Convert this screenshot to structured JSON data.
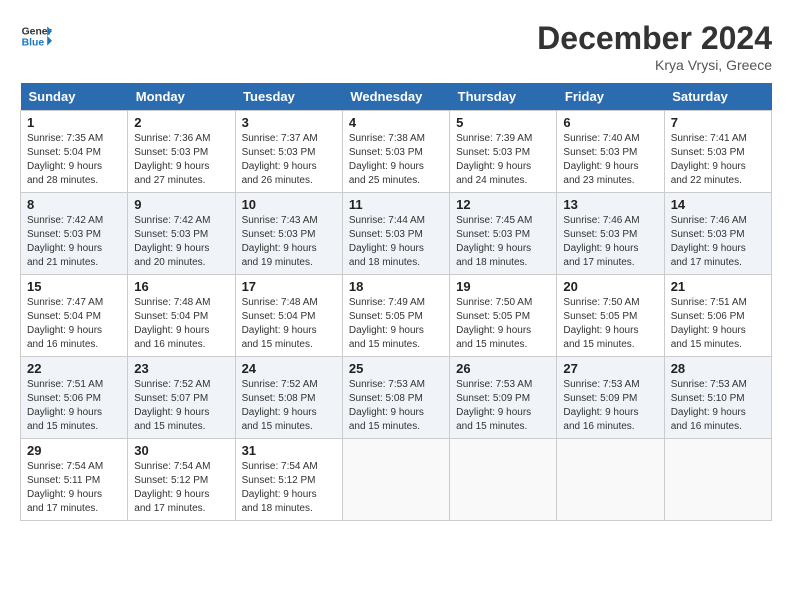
{
  "header": {
    "logo_line1": "General",
    "logo_line2": "Blue",
    "month_title": "December 2024",
    "location": "Krya Vrysi, Greece"
  },
  "weekdays": [
    "Sunday",
    "Monday",
    "Tuesday",
    "Wednesday",
    "Thursday",
    "Friday",
    "Saturday"
  ],
  "weeks": [
    [
      {
        "day": "1",
        "sunrise": "Sunrise: 7:35 AM",
        "sunset": "Sunset: 5:04 PM",
        "daylight": "Daylight: 9 hours and 28 minutes."
      },
      {
        "day": "2",
        "sunrise": "Sunrise: 7:36 AM",
        "sunset": "Sunset: 5:03 PM",
        "daylight": "Daylight: 9 hours and 27 minutes."
      },
      {
        "day": "3",
        "sunrise": "Sunrise: 7:37 AM",
        "sunset": "Sunset: 5:03 PM",
        "daylight": "Daylight: 9 hours and 26 minutes."
      },
      {
        "day": "4",
        "sunrise": "Sunrise: 7:38 AM",
        "sunset": "Sunset: 5:03 PM",
        "daylight": "Daylight: 9 hours and 25 minutes."
      },
      {
        "day": "5",
        "sunrise": "Sunrise: 7:39 AM",
        "sunset": "Sunset: 5:03 PM",
        "daylight": "Daylight: 9 hours and 24 minutes."
      },
      {
        "day": "6",
        "sunrise": "Sunrise: 7:40 AM",
        "sunset": "Sunset: 5:03 PM",
        "daylight": "Daylight: 9 hours and 23 minutes."
      },
      {
        "day": "7",
        "sunrise": "Sunrise: 7:41 AM",
        "sunset": "Sunset: 5:03 PM",
        "daylight": "Daylight: 9 hours and 22 minutes."
      }
    ],
    [
      {
        "day": "8",
        "sunrise": "Sunrise: 7:42 AM",
        "sunset": "Sunset: 5:03 PM",
        "daylight": "Daylight: 9 hours and 21 minutes."
      },
      {
        "day": "9",
        "sunrise": "Sunrise: 7:42 AM",
        "sunset": "Sunset: 5:03 PM",
        "daylight": "Daylight: 9 hours and 20 minutes."
      },
      {
        "day": "10",
        "sunrise": "Sunrise: 7:43 AM",
        "sunset": "Sunset: 5:03 PM",
        "daylight": "Daylight: 9 hours and 19 minutes."
      },
      {
        "day": "11",
        "sunrise": "Sunrise: 7:44 AM",
        "sunset": "Sunset: 5:03 PM",
        "daylight": "Daylight: 9 hours and 18 minutes."
      },
      {
        "day": "12",
        "sunrise": "Sunrise: 7:45 AM",
        "sunset": "Sunset: 5:03 PM",
        "daylight": "Daylight: 9 hours and 18 minutes."
      },
      {
        "day": "13",
        "sunrise": "Sunrise: 7:46 AM",
        "sunset": "Sunset: 5:03 PM",
        "daylight": "Daylight: 9 hours and 17 minutes."
      },
      {
        "day": "14",
        "sunrise": "Sunrise: 7:46 AM",
        "sunset": "Sunset: 5:03 PM",
        "daylight": "Daylight: 9 hours and 17 minutes."
      }
    ],
    [
      {
        "day": "15",
        "sunrise": "Sunrise: 7:47 AM",
        "sunset": "Sunset: 5:04 PM",
        "daylight": "Daylight: 9 hours and 16 minutes."
      },
      {
        "day": "16",
        "sunrise": "Sunrise: 7:48 AM",
        "sunset": "Sunset: 5:04 PM",
        "daylight": "Daylight: 9 hours and 16 minutes."
      },
      {
        "day": "17",
        "sunrise": "Sunrise: 7:48 AM",
        "sunset": "Sunset: 5:04 PM",
        "daylight": "Daylight: 9 hours and 15 minutes."
      },
      {
        "day": "18",
        "sunrise": "Sunrise: 7:49 AM",
        "sunset": "Sunset: 5:05 PM",
        "daylight": "Daylight: 9 hours and 15 minutes."
      },
      {
        "day": "19",
        "sunrise": "Sunrise: 7:50 AM",
        "sunset": "Sunset: 5:05 PM",
        "daylight": "Daylight: 9 hours and 15 minutes."
      },
      {
        "day": "20",
        "sunrise": "Sunrise: 7:50 AM",
        "sunset": "Sunset: 5:05 PM",
        "daylight": "Daylight: 9 hours and 15 minutes."
      },
      {
        "day": "21",
        "sunrise": "Sunrise: 7:51 AM",
        "sunset": "Sunset: 5:06 PM",
        "daylight": "Daylight: 9 hours and 15 minutes."
      }
    ],
    [
      {
        "day": "22",
        "sunrise": "Sunrise: 7:51 AM",
        "sunset": "Sunset: 5:06 PM",
        "daylight": "Daylight: 9 hours and 15 minutes."
      },
      {
        "day": "23",
        "sunrise": "Sunrise: 7:52 AM",
        "sunset": "Sunset: 5:07 PM",
        "daylight": "Daylight: 9 hours and 15 minutes."
      },
      {
        "day": "24",
        "sunrise": "Sunrise: 7:52 AM",
        "sunset": "Sunset: 5:08 PM",
        "daylight": "Daylight: 9 hours and 15 minutes."
      },
      {
        "day": "25",
        "sunrise": "Sunrise: 7:53 AM",
        "sunset": "Sunset: 5:08 PM",
        "daylight": "Daylight: 9 hours and 15 minutes."
      },
      {
        "day": "26",
        "sunrise": "Sunrise: 7:53 AM",
        "sunset": "Sunset: 5:09 PM",
        "daylight": "Daylight: 9 hours and 15 minutes."
      },
      {
        "day": "27",
        "sunrise": "Sunrise: 7:53 AM",
        "sunset": "Sunset: 5:09 PM",
        "daylight": "Daylight: 9 hours and 16 minutes."
      },
      {
        "day": "28",
        "sunrise": "Sunrise: 7:53 AM",
        "sunset": "Sunset: 5:10 PM",
        "daylight": "Daylight: 9 hours and 16 minutes."
      }
    ],
    [
      {
        "day": "29",
        "sunrise": "Sunrise: 7:54 AM",
        "sunset": "Sunset: 5:11 PM",
        "daylight": "Daylight: 9 hours and 17 minutes."
      },
      {
        "day": "30",
        "sunrise": "Sunrise: 7:54 AM",
        "sunset": "Sunset: 5:12 PM",
        "daylight": "Daylight: 9 hours and 17 minutes."
      },
      {
        "day": "31",
        "sunrise": "Sunrise: 7:54 AM",
        "sunset": "Sunset: 5:12 PM",
        "daylight": "Daylight: 9 hours and 18 minutes."
      },
      null,
      null,
      null,
      null
    ]
  ]
}
